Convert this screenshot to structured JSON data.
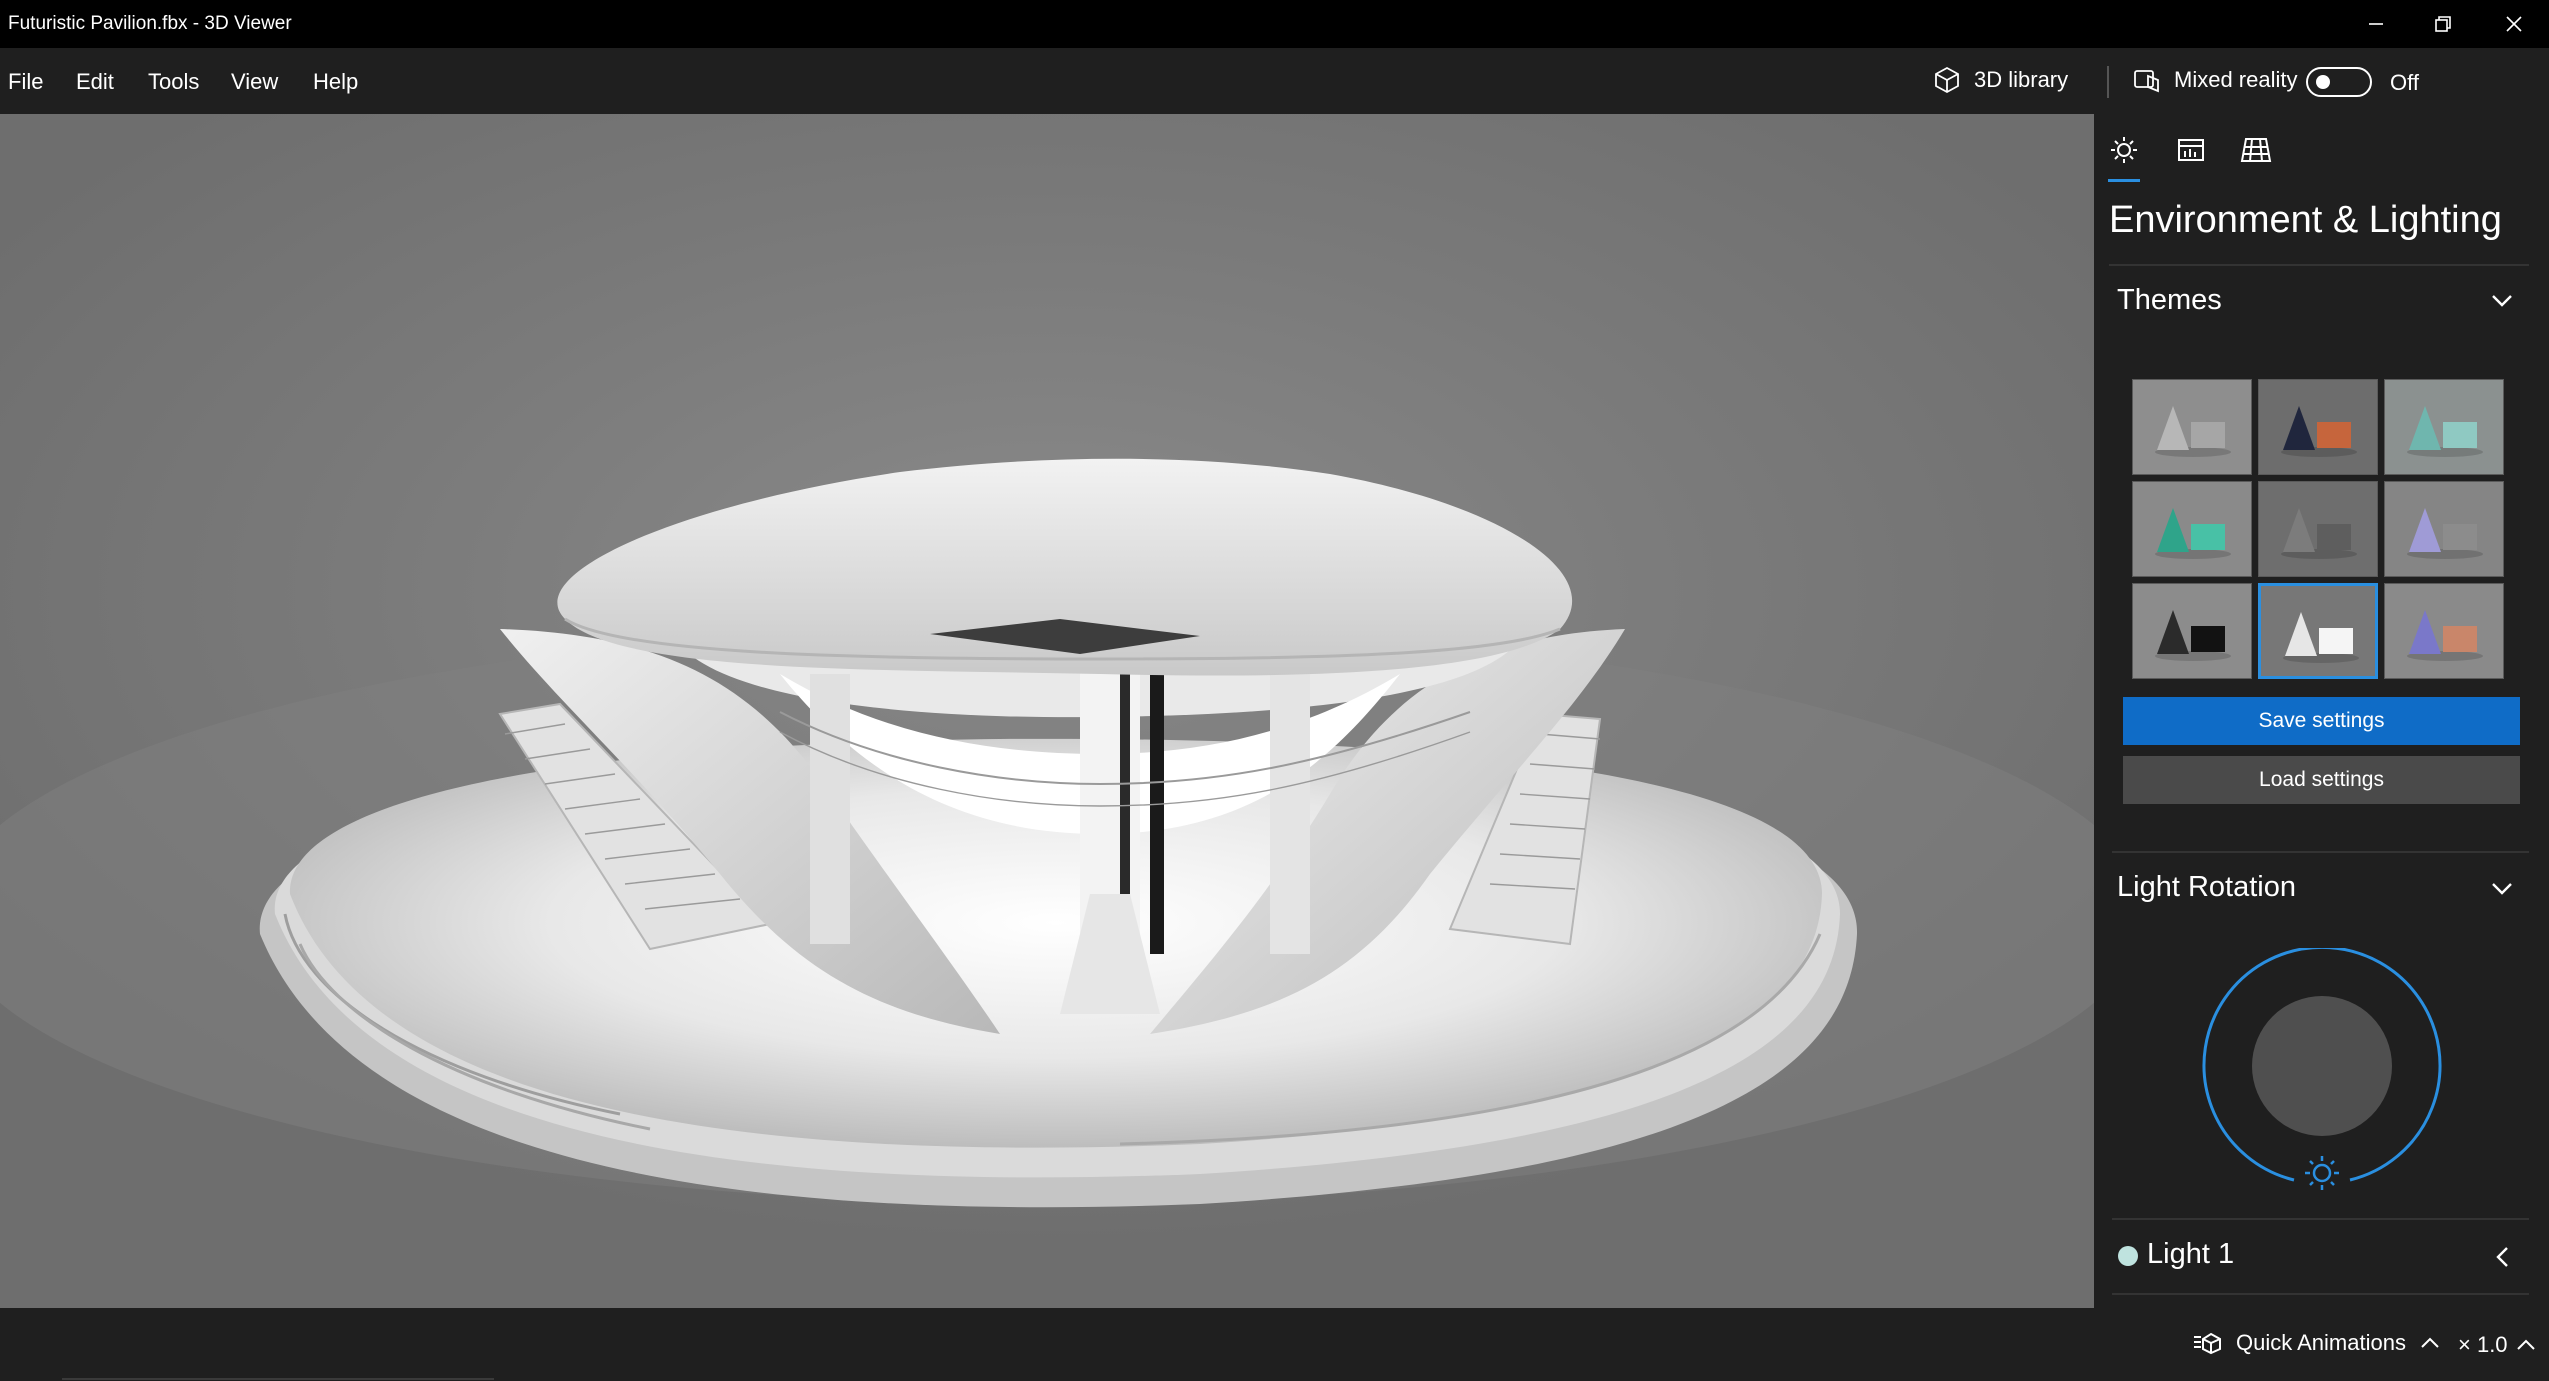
{
  "window": {
    "title": "Futuristic Pavilion.fbx - 3D Viewer"
  },
  "menu": {
    "items": [
      "File",
      "Edit",
      "Tools",
      "View",
      "Help"
    ]
  },
  "toolbar": {
    "library_label": "3D library",
    "mixed_reality_label": "Mixed reality",
    "mixed_reality_state": "Off"
  },
  "panel": {
    "title": "Environment & Lighting",
    "tabs": [
      {
        "icon": "sun-icon",
        "active": true
      },
      {
        "icon": "stats-icon",
        "active": false
      },
      {
        "icon": "grid-icon",
        "active": false
      }
    ],
    "themes_section": {
      "label": "Themes",
      "selected_index": 7,
      "swatches": [
        {
          "bg": "#8e8e8e",
          "shape": "#b7b7b7",
          "box": "#a6a6a6"
        },
        {
          "bg": "#6d6d6d",
          "shape": "#20263d",
          "box": "#c6653c"
        },
        {
          "bg": "#8b9190",
          "shape": "#6fb6ae",
          "box": "#8fc9c2"
        },
        {
          "bg": "#8a8a8a",
          "shape": "#2fa48a",
          "box": "#48c1a6"
        },
        {
          "bg": "#6e6e6e",
          "shape": "#7c7c7c",
          "box": "#5e5e5e"
        },
        {
          "bg": "#858585",
          "shape": "#9f9bd6",
          "box": "#8c8c8c"
        },
        {
          "bg": "#8c8c8c",
          "shape": "#2b2b2b",
          "box": "#121212"
        },
        {
          "bg": "#777777",
          "shape": "#e6e6e6",
          "box": "#f5f5f5"
        },
        {
          "bg": "#8a8a8a",
          "shape": "#7a78c9",
          "box": "#c9866a"
        }
      ],
      "save_label": "Save settings",
      "load_label": "Load settings"
    },
    "light_rotation": {
      "label": "Light Rotation"
    },
    "light": {
      "label": "Light 1",
      "color": "#bfe3df"
    }
  },
  "statusbar": {
    "animations_label": "Quick Animations",
    "speed_label": "× 1.0"
  },
  "colors": {
    "accent": "#0f6cc7",
    "accent_light": "#2a8fe0",
    "panel_bg": "#1f1f1f",
    "titlebar_bg": "#000000"
  }
}
